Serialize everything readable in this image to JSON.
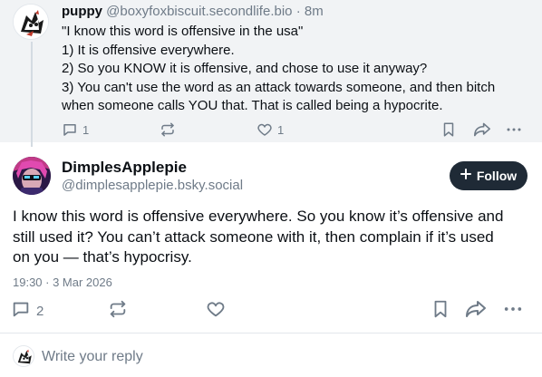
{
  "parent_post": {
    "author_name": "puppy",
    "author_handle": "@boxyfoxbiscuit.secondlife.bio",
    "separator": "·",
    "time": "8m",
    "lines": [
      "\"I know this word is offensive in the usa\"",
      "1) It is offensive everywhere.",
      "2) So you KNOW it is offensive, and chose to use it anyway?",
      "3) You can't use the word as an attack towards someone, and then bitch",
      "when someone calls YOU that. That is called being a hypocrite."
    ],
    "reply_count": "1",
    "like_count": "1"
  },
  "main_post": {
    "author_name": "DimplesApplepie",
    "author_handle": "@dimplesapplepie.bsky.social",
    "follow_label": "Follow",
    "lines": [
      "I know this word is offensive everywhere. So you know it’s offensive and",
      "still used it? You can’t attack someone with it, then complain if it’s used",
      "on you — that’s hypocrisy."
    ],
    "timestamp": "19:30 · 3 Mar 2026",
    "reply_count": "2"
  },
  "reply_bar": {
    "placeholder": "Write your reply"
  },
  "icons": {
    "reply": "reply-icon",
    "repost": "repost-icon",
    "like": "like-icon",
    "bookmark": "bookmark-icon",
    "share": "share-icon",
    "more": "more-icon"
  },
  "colors": {
    "text": "#0b0f14",
    "muted": "#6f7b88",
    "parent_background": "#f1f3f5",
    "follow_button": "#1f2a36"
  }
}
